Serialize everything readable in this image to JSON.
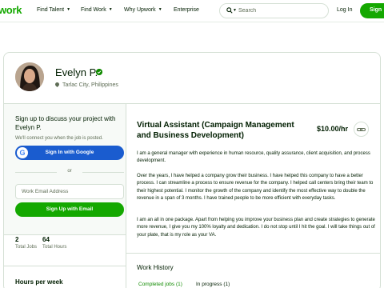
{
  "nav": {
    "logo": "work",
    "items": [
      {
        "label": "Find Talent",
        "caret": "▼"
      },
      {
        "label": "Find Work",
        "caret": "▼"
      },
      {
        "label": "Why Upwork",
        "caret": "▼"
      },
      {
        "label": "Enterprise"
      }
    ],
    "search_placeholder": "Search",
    "login": "Log In",
    "signup": "Sign"
  },
  "profile": {
    "name": "Evelyn P.",
    "location": "Tarlac City, Philippines"
  },
  "sidebar": {
    "title": "Sign up to discuss your project with Evelyn P.",
    "subtitle": "We'll connect you when the job is posted.",
    "google_button": "Sign In with Google",
    "google_glyph": "G",
    "or": "or",
    "email_placeholder": "Work Email Address",
    "email_button": "Sign Up with Email",
    "stats": [
      {
        "value": "2",
        "label": "Total Jobs"
      },
      {
        "value": "64",
        "label": "Total Hours"
      }
    ],
    "hours_title": "Hours per week"
  },
  "main": {
    "title": "Virtual Assistant (Campaign Management and Business Development)",
    "rate": "$10.00/hr",
    "paragraphs": [
      "I am a general manager with experience in human resource, quality assurance, client acquisition, and process development.",
      "Over the years, I have helped a company grow their business. I have helped this company to have a better process. I can streamline a process to ensure revenue for the company. I helped call centers bring their team to their highest potential. I monitor the growth of the company and identify the most effective way to double the revenue in a span of 3 months. I have trained people to be more efficient with everyday tasks.",
      "I am an all in one package. Apart from helping you improve your business plan and create strategies to generate more revenue, I give you my 100% loyalty and dedication. I do not stop until I hit the goal. I will take things out of your plate, that is my role as your VA."
    ],
    "work_history_title": "Work History",
    "tabs": [
      {
        "label": "Completed jobs (1)",
        "active": true
      },
      {
        "label": "In progress (1)",
        "active": false
      }
    ]
  },
  "colors": {
    "brand_green": "#14a800",
    "google_blue": "#1a5ccf",
    "text": "#001e00",
    "muted": "#5e6d55"
  }
}
